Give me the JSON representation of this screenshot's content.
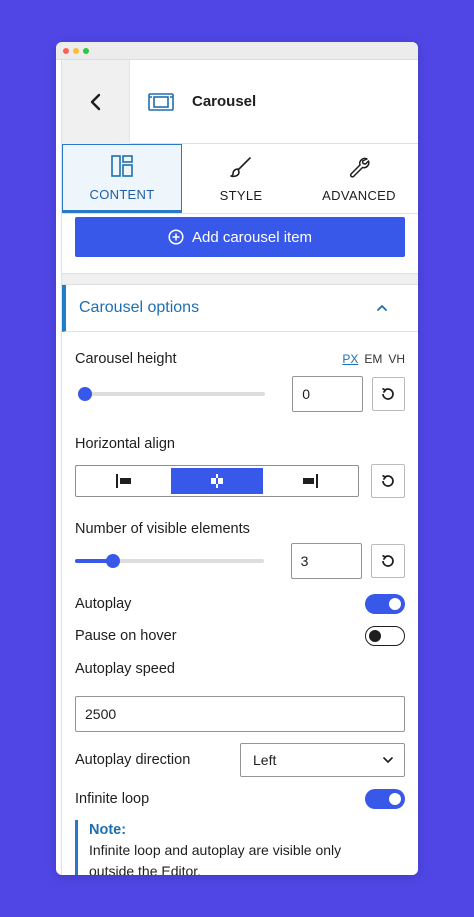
{
  "colors": {
    "background": "#4f46e5",
    "accent": "#3858e9",
    "link": "#1e6fb0"
  },
  "header": {
    "title": "Carousel",
    "back_icon": "chevron-left-icon",
    "widget_icon": "carousel-icon"
  },
  "tabs": [
    {
      "label": "CONTENT",
      "icon": "layout-icon",
      "active": true
    },
    {
      "label": "STYLE",
      "icon": "brush-icon",
      "active": false
    },
    {
      "label": "ADVANCED",
      "icon": "wrench-icon",
      "active": false
    }
  ],
  "add_button": {
    "label": "Add carousel item",
    "icon": "plus-circle-icon"
  },
  "section": {
    "title": "Carousel options",
    "icon": "chevron-up-icon"
  },
  "carousel_height": {
    "label": "Carousel height",
    "units": [
      "PX",
      "EM",
      "VH"
    ],
    "active_unit": "PX",
    "value": "0",
    "slider_fraction": 0.0
  },
  "horizontal_align": {
    "label": "Horizontal align",
    "options": [
      "left",
      "center",
      "right"
    ],
    "selected": "center"
  },
  "visible_elements": {
    "label": "Number of visible elements",
    "value": "3",
    "slider_fraction": 0.2
  },
  "autoplay": {
    "label": "Autoplay",
    "on": true
  },
  "pause_on_hover": {
    "label": "Pause on hover",
    "on": false
  },
  "autoplay_speed": {
    "label": "Autoplay speed",
    "value": "2500"
  },
  "autoplay_direction": {
    "label": "Autoplay direction",
    "value": "Left"
  },
  "infinite_loop": {
    "label": "Infinite loop",
    "on": true
  },
  "note": {
    "title": "Note:",
    "text_line1": "Infinite loop and autoplay are visible only",
    "text_line2": "outside the Editor."
  }
}
